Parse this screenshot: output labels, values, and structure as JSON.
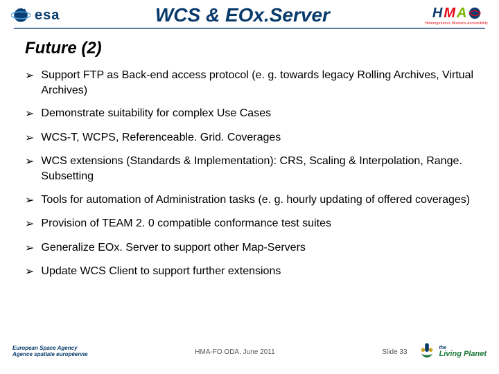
{
  "header": {
    "esa_text": "esa",
    "title": "WCS & EOx.Server",
    "hma": {
      "h": "H",
      "m": "M",
      "a": "A",
      "sub": "Heterogeneous Missions Accessibility"
    }
  },
  "subtitle": "Future (2)",
  "bullets": [
    "Support FTP as Back-end access protocol (e. g. towards legacy Rolling Archives, Virtual Archives)",
    "Demonstrate suitability for complex Use Cases",
    "WCS-T, WCPS, Referenceable. Grid. Coverages",
    "WCS extensions (Standards & Implementation): CRS, Scaling & Interpolation, Range. Subsetting",
    "Tools for automation of Administration tasks (e. g. hourly updating of offered coverages)",
    "Provision of TEAM 2. 0 compatible conformance test suites",
    "Generalize EOx. Server to support other Map-Servers",
    "Update WCS Client to support further extensions"
  ],
  "footer": {
    "esa_line1": "European Space Agency",
    "esa_line2": "Agence spatiale européenne",
    "mid": "HMA-FO ODA, June 2011",
    "slide": "Slide 33",
    "living_l1": "the",
    "living_l2": "Living Planet"
  },
  "bullet_mark": "➢"
}
